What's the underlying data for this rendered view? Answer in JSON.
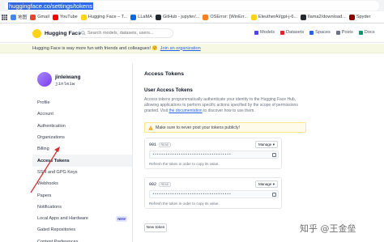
{
  "browser": {
    "url": "huggingface.co/settings/tokens",
    "bookmarks": [
      {
        "label": "地图",
        "color": "#4285f4"
      },
      {
        "label": "Gmail",
        "color": "#ea4335"
      },
      {
        "label": "YouTube",
        "color": "#ff0000"
      },
      {
        "label": "Hugging Face – T...",
        "color": "#ffd21e"
      },
      {
        "label": "LLaMA",
        "color": "#0668e1"
      },
      {
        "label": "GitHub - jupyter/...",
        "color": "#24292f"
      },
      {
        "label": "OSError: [WinErr...",
        "color": "#f48024"
      },
      {
        "label": "EleutherAI/gpt-j-6...",
        "color": "#ffd21e"
      },
      {
        "label": "llama2/download...",
        "color": "#24292f"
      },
      {
        "label": "Spyder",
        "color": "#8c0000"
      }
    ]
  },
  "header": {
    "brand": "Hugging Face",
    "search_placeholder": "Search models, datasets, users...",
    "nav": [
      {
        "label": "Models",
        "icon": "models-icon"
      },
      {
        "label": "Datasets",
        "icon": "datasets-icon"
      },
      {
        "label": "Spaces",
        "icon": "spaces-icon"
      },
      {
        "label": "Posts",
        "icon": "posts-icon"
      },
      {
        "label": "Docs",
        "icon": "docs-icon"
      }
    ]
  },
  "promo": {
    "text": "Hugging Face is way more fun with friends and colleagues! 🤗",
    "link": "Join an organization"
  },
  "profile": {
    "fullname": "jinleiwang",
    "username": "jinleiw"
  },
  "sidebar": {
    "items": [
      {
        "label": "Profile",
        "badge": ""
      },
      {
        "label": "Account",
        "badge": ""
      },
      {
        "label": "Authentication",
        "badge": ""
      },
      {
        "label": "Organizations",
        "badge": ""
      },
      {
        "label": "Billing",
        "badge": ""
      },
      {
        "label": "Access Tokens",
        "badge": "",
        "active": true
      },
      {
        "label": "SSH and GPG Keys",
        "badge": ""
      },
      {
        "label": "Webhooks",
        "badge": ""
      },
      {
        "label": "Papers",
        "badge": ""
      },
      {
        "label": "Notifications",
        "badge": ""
      },
      {
        "label": "Local Apps and Hardware",
        "badge": "NEW"
      },
      {
        "label": "Gated Repositories",
        "badge": ""
      },
      {
        "label": "Content Preferences",
        "badge": ""
      }
    ]
  },
  "main": {
    "title": "Access Tokens",
    "section_title": "User Access Tokens",
    "description": "Access tokens programmatically authenticate your identity to the Hugging Face Hub, allowing applications to perform specific actions specified by the scope of permissions granted.",
    "description_link_pre": "Visit",
    "description_link": "the documentation",
    "description_link_post": "to discover how to use them.",
    "warning": "Make sure to never post your tokens publicly!",
    "tokens": [
      {
        "name": "001",
        "role": "READ",
        "manage": "Manage",
        "value": "••••••••••••••••••••••••••••••••••••",
        "hint": "Refresh the token in order to copy its value."
      },
      {
        "name": "002",
        "role": "READ",
        "manage": "Manage",
        "value": "••••••••••••••••••••••••••••••••••••",
        "hint": "Refresh the token in order to copy its value."
      }
    ],
    "new_token": "New token"
  },
  "watermark": "知乎 @王金垒"
}
